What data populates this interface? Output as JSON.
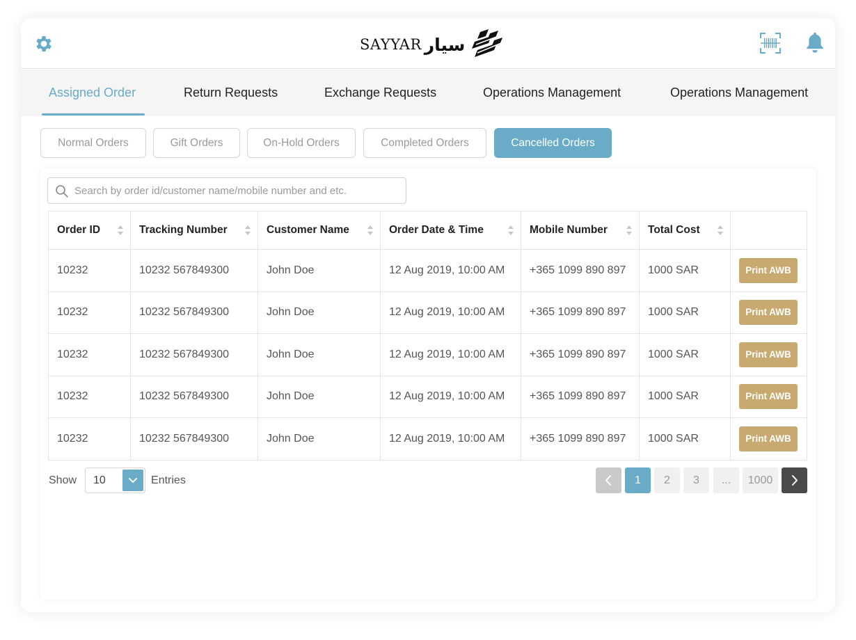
{
  "header": {
    "logo_en": "SAYYAR",
    "logo_ar": "سيار"
  },
  "tabs": [
    {
      "label": "Assigned Order",
      "active": true
    },
    {
      "label": "Return Requests",
      "active": false
    },
    {
      "label": "Exchange Requests",
      "active": false
    },
    {
      "label": "Operations Management",
      "active": false
    },
    {
      "label": "Operations Management",
      "active": false
    }
  ],
  "subtabs": [
    {
      "label": "Normal Orders",
      "active": false
    },
    {
      "label": "Gift Orders",
      "active": false
    },
    {
      "label": "On-Hold Orders",
      "active": false
    },
    {
      "label": "Completed Orders",
      "active": false
    },
    {
      "label": "Cancelled Orders",
      "active": true
    }
  ],
  "search": {
    "placeholder": "Search by order id/customer name/mobile number and etc."
  },
  "table": {
    "columns": [
      "Order ID",
      "Tracking Number",
      "Customer Name",
      "Order Date & Time",
      "Mobile Number",
      "Total Cost",
      ""
    ],
    "action_label": "Print AWB",
    "rows": [
      [
        "10232",
        "10232 567849300",
        "John Doe",
        "12 Aug 2019, 10:00 AM",
        "+365 1099 890 897",
        "1000 SAR"
      ],
      [
        "10232",
        "10232 567849300",
        "John Doe",
        "12 Aug 2019, 10:00 AM",
        "+365 1099 890 897",
        "1000 SAR"
      ],
      [
        "10232",
        "10232 567849300",
        "John Doe",
        "12 Aug 2019, 10:00 AM",
        "+365 1099 890 897",
        "1000 SAR"
      ],
      [
        "10232",
        "10232 567849300",
        "John Doe",
        "12 Aug 2019, 10:00 AM",
        "+365 1099 890 897",
        "1000 SAR"
      ],
      [
        "10232",
        "10232 567849300",
        "John Doe",
        "12 Aug 2019, 10:00 AM",
        "+365 1099 890 897",
        "1000 SAR"
      ]
    ]
  },
  "footer": {
    "show_label": "Show",
    "entries_value": "10",
    "entries_label": "Entries"
  },
  "pagination": {
    "pages": [
      "1",
      "2",
      "3",
      "...",
      "1000"
    ],
    "current": "1"
  },
  "colors": {
    "accent": "#6aabc7",
    "button": "#c8a96f",
    "icon": "#6aabc7"
  }
}
